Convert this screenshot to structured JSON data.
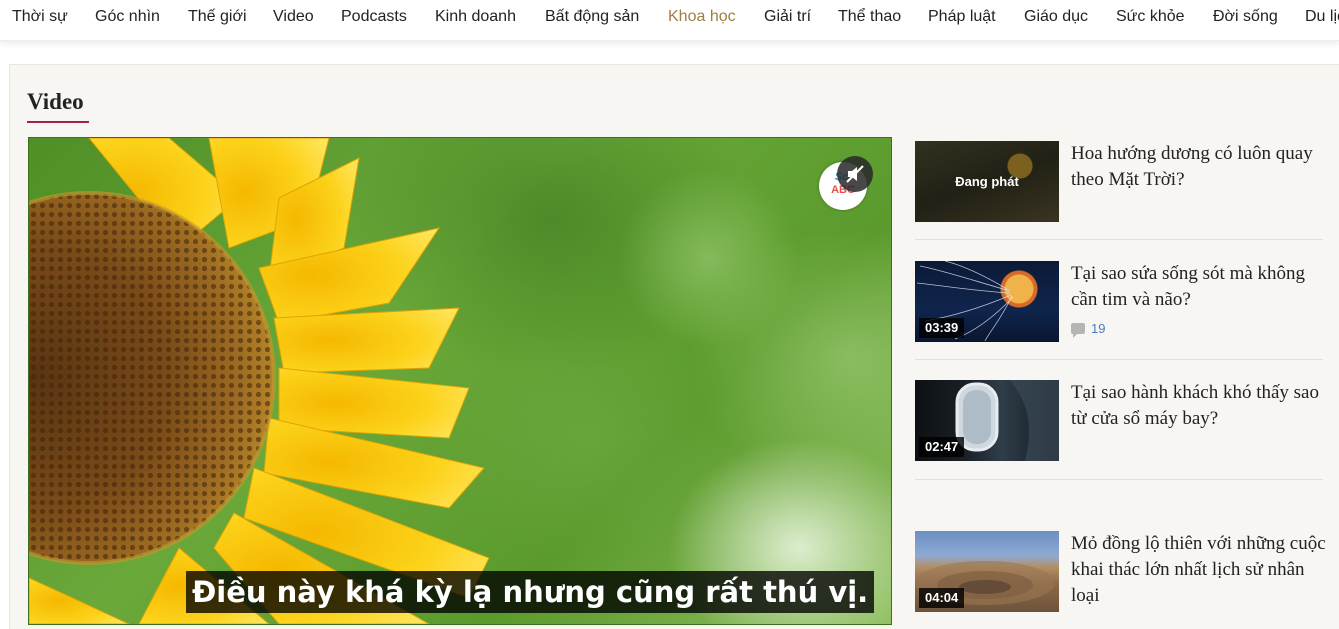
{
  "nav": {
    "items": [
      {
        "label": "Thời sự",
        "active": false
      },
      {
        "label": "Góc nhìn",
        "active": false
      },
      {
        "label": "Thế giới",
        "active": false
      },
      {
        "label": "Video",
        "active": false
      },
      {
        "label": "Podcasts",
        "active": false
      },
      {
        "label": "Kinh doanh",
        "active": false
      },
      {
        "label": "Bất động sản",
        "active": false
      },
      {
        "label": "Khoa học",
        "active": true
      },
      {
        "label": "Giải trí",
        "active": false
      },
      {
        "label": "Thể thao",
        "active": false
      },
      {
        "label": "Pháp luật",
        "active": false
      },
      {
        "label": "Giáo dục",
        "active": false
      },
      {
        "label": "Sức khỏe",
        "active": false
      },
      {
        "label": "Đời sống",
        "active": false
      },
      {
        "label": "Du lịch",
        "active": false
      }
    ],
    "active_color": "#9f7f3f"
  },
  "section": {
    "title": "Video",
    "underline_color": "#9f224e"
  },
  "player": {
    "subtitle": "Điều này khá kỳ lạ nhưng cũng rất thú vị.",
    "brand_top": "Sci",
    "brand_bottom": "ABC",
    "muted": true
  },
  "side_videos": [
    {
      "title": "Hoa hướng dương có luôn quay theo Mặt Trời?",
      "status": "Đang phát",
      "duration": null,
      "comments": null,
      "thumb": "sunflower-field"
    },
    {
      "title": "Tại sao sứa sống sót mà không cần tim và não?",
      "status": null,
      "duration": "03:39",
      "comments": "19",
      "thumb": "jellyfish"
    },
    {
      "title": "Tại sao hành khách khó thấy sao từ cửa sổ máy bay?",
      "status": null,
      "duration": "02:47",
      "comments": null,
      "thumb": "airplane-window"
    },
    {
      "title": "Mỏ đồng lộ thiên với những cuộc khai thác lớn nhất lịch sử nhân loại",
      "status": null,
      "duration": "04:04",
      "comments": null,
      "thumb": "open-pit-mine"
    }
  ]
}
